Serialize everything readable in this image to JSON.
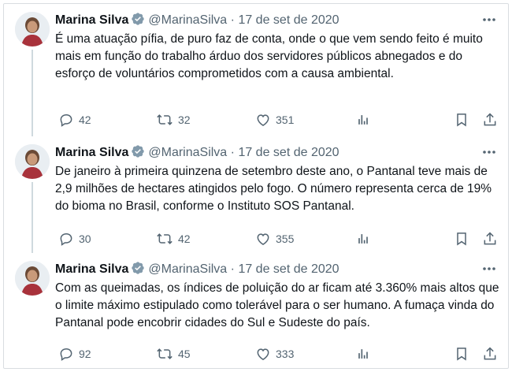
{
  "tweets": [
    {
      "name": "Marina Silva",
      "handle": "@MarinaSilva",
      "separator": "·",
      "date": "17 de set de 2020",
      "text": "É uma atuação pífia, de puro faz de conta, onde o que vem sendo feito é muito mais em função do trabalho árduo dos servidores públicos abnegados e do esforço de voluntários comprometidos com a causa ambiental.",
      "replies": "42",
      "retweets": "32",
      "likes": "351"
    },
    {
      "name": "Marina Silva",
      "handle": "@MarinaSilva",
      "separator": "·",
      "date": "17 de set de 2020",
      "text": "De janeiro à primeira quinzena de setembro deste ano, o Pantanal teve mais de 2,9 milhões de hectares atingidos pelo fogo. O número representa cerca de 19% do bioma no Brasil, conforme o Instituto SOS Pantanal.",
      "replies": "30",
      "retweets": "42",
      "likes": "355"
    },
    {
      "name": "Marina Silva",
      "handle": "@MarinaSilva",
      "separator": "·",
      "date": "17 de set de 2020",
      "text": "Com as queimadas, os índices de poluição do ar ficam até 3.360%  mais altos que o limite máximo estipulado como tolerável para o ser humano. A fumaça vinda do Pantanal pode encobrir cidades do Sul e Sudeste do país.",
      "replies": "92",
      "retweets": "45",
      "likes": "333"
    }
  ],
  "colors": {
    "text": "#0f1419",
    "muted": "#536471",
    "verified": "#829aab",
    "thread_line": "#cfd9de"
  },
  "icons": [
    "verified-badge-icon",
    "more-icon",
    "reply-icon",
    "retweet-icon",
    "like-icon",
    "views-icon",
    "bookmark-icon",
    "share-icon"
  ]
}
